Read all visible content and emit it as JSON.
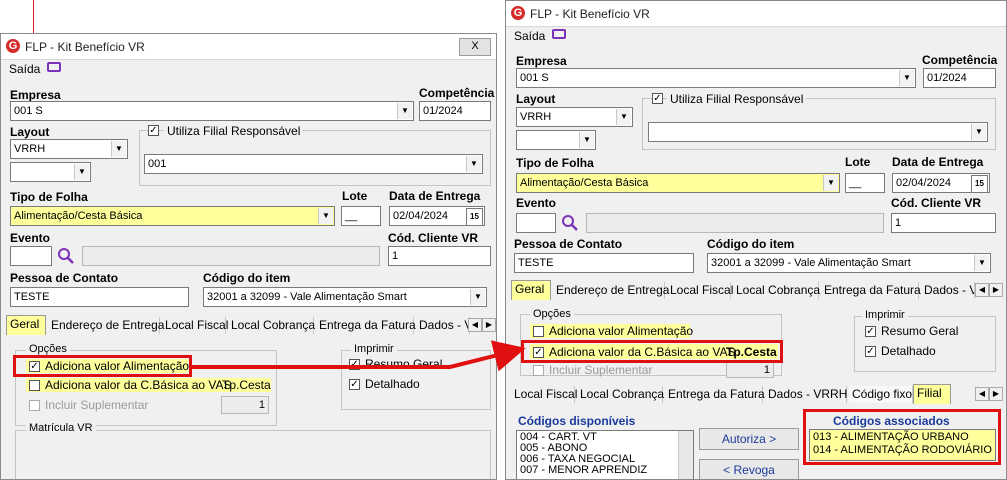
{
  "left_window": {
    "title": "FLP - Kit Benefício VR",
    "close_label": "X",
    "menu_saida": "Saída",
    "empresa_label": "Empresa",
    "empresa_value": "001 S",
    "competencia_label": "Competência",
    "competencia_value": "01/2024",
    "layout_label": "Layout",
    "layout_value": "VRRH",
    "utiliza_filial_label": "Utiliza Filial Responsável",
    "filial_value": "001",
    "tipo_folha_label": "Tipo de Folha",
    "tipo_folha_value": "Alimentação/Cesta Básica",
    "lote_label": "Lote",
    "data_entrega_label": "Data de Entrega",
    "data_entrega_value": "02/04/2024",
    "evento_label": "Evento",
    "cod_cliente_label": "Cód. Cliente VR",
    "cod_cliente_value": "1",
    "pessoa_contato_label": "Pessoa de Contato",
    "pessoa_contato_value": "TESTE",
    "codigo_item_label": "Código do item",
    "codigo_item_value": "32001 a 32099 - Vale Alimentação Smart",
    "tabs": [
      "Geral",
      "Endereço de Entrega",
      "Local Fiscal",
      "Local Cobrança",
      "Entrega da Fatura",
      "Dados - V"
    ],
    "opcoes_label": "Opções",
    "adiciona_alimentacao": "Adiciona valor Alimentação",
    "adiciona_cbasica": "Adiciona valor da C.Básica ao VAS",
    "tp_cesta": "Tp.Cesta",
    "incluir_suplementar": "Incluir Suplementar",
    "suplementar_value": "1",
    "imprimir_label": "Imprimir",
    "resumo_geral": "Resumo Geral",
    "detalhado": "Detalhado",
    "matricula_label": "Matrícula VR",
    "calendar_glyph": "15"
  },
  "right_window": {
    "title": "FLP - Kit Benefício VR",
    "menu_saida": "Saída",
    "empresa_label": "Empresa",
    "empresa_value": "001 S",
    "competencia_label": "Competência",
    "competencia_value": "01/2024",
    "layout_label": "Layout",
    "layout_value": "VRRH",
    "utiliza_filial_label": "Utiliza Filial Responsável",
    "tipo_folha_label": "Tipo de Folha",
    "tipo_folha_value": "Alimentação/Cesta Básica",
    "lote_label": "Lote",
    "data_entrega_label": "Data de Entrega",
    "data_entrega_value": "02/04/2024",
    "evento_label": "Evento",
    "cod_cliente_label": "Cód. Cliente VR",
    "cod_cliente_value": "1",
    "pessoa_contato_label": "Pessoa de Contato",
    "pessoa_contato_value": "TESTE",
    "codigo_item_label": "Código do item",
    "codigo_item_value": "32001 a 32099 - Vale Alimentação Smart",
    "tabs": [
      "Geral",
      "Endereço de Entrega",
      "Local Fiscal",
      "Local Cobrança",
      "Entrega da Fatura",
      "Dados - V"
    ],
    "opcoes_label": "Opções",
    "adiciona_alimentacao": "Adiciona valor Alimentação",
    "adiciona_cbasica": "Adiciona valor da C.Básica ao VAS",
    "tp_cesta": "Tp.Cesta",
    "incluir_suplementar": "Incluir Suplementar",
    "suplementar_value": "1",
    "imprimir_label": "Imprimir",
    "resumo_geral": "Resumo Geral",
    "detalhado": "Detalhado",
    "subtabs": [
      "Local Fiscal",
      "Local Cobrança",
      "Entrega da Fatura",
      "Dados - VRRH",
      "Código fixo",
      "Filial"
    ],
    "codigos_disponiveis_label": "Códigos disponíveis",
    "codigos_disponiveis": [
      "004 - CART. VT",
      "005 - ABONO",
      "006 - TAXA NEGOCIAL",
      "007 - MENOR APRENDIZ"
    ],
    "autoriza_button": "Autoriza >",
    "revoga_button": "< Revoga",
    "codigos_associados_label": "Códigos associados",
    "codigos_associados": [
      "013 - ALIMENTAÇÃO URBANO",
      "014 - ALIMENTAÇÃO RODOVIÁRIO"
    ],
    "calendar_glyph": "15"
  },
  "colors": {
    "highlight_yellow": "#ffff9c",
    "annotation_red": "#e01010",
    "brand_red": "#d62b2b",
    "link_blue": "#1a3a9a"
  },
  "icons": [
    "app-logo-icon",
    "monitor-icon",
    "dropdown-arrow-icon",
    "calendar-icon",
    "search-icon",
    "checkbox-icon",
    "annotation-arrow-icon"
  ]
}
